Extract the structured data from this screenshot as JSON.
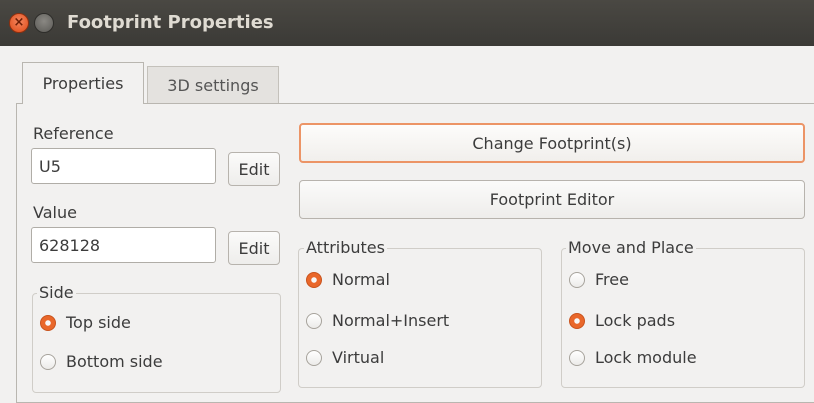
{
  "window": {
    "title": "Footprint Properties"
  },
  "tabs": [
    {
      "label": "Properties",
      "active": true
    },
    {
      "label": "3D settings",
      "active": false
    }
  ],
  "reference": {
    "label": "Reference",
    "value": "U5",
    "edit_label": "Edit"
  },
  "value_field": {
    "label": "Value",
    "value": "628128",
    "edit_label": "Edit"
  },
  "side": {
    "title": "Side",
    "options": [
      {
        "label": "Top side",
        "selected": true
      },
      {
        "label": "Bottom side",
        "selected": false
      }
    ]
  },
  "buttons": {
    "change_footprint": "Change Footprint(s)",
    "footprint_editor": "Footprint Editor"
  },
  "attributes": {
    "title": "Attributes",
    "options": [
      {
        "label": "Normal",
        "selected": true
      },
      {
        "label": "Normal+Insert",
        "selected": false
      },
      {
        "label": "Virtual",
        "selected": false
      }
    ]
  },
  "move_place": {
    "title": "Move and Place",
    "options": [
      {
        "label": "Free",
        "selected": false
      },
      {
        "label": "Lock pads",
        "selected": true
      },
      {
        "label": "Lock module",
        "selected": false
      }
    ]
  },
  "colors": {
    "accent": "#e9672a",
    "titlebar": "#3c3b37",
    "close_button": "#df4a16"
  },
  "icons": {
    "close": "close-icon",
    "minimize": "minimize-icon"
  }
}
